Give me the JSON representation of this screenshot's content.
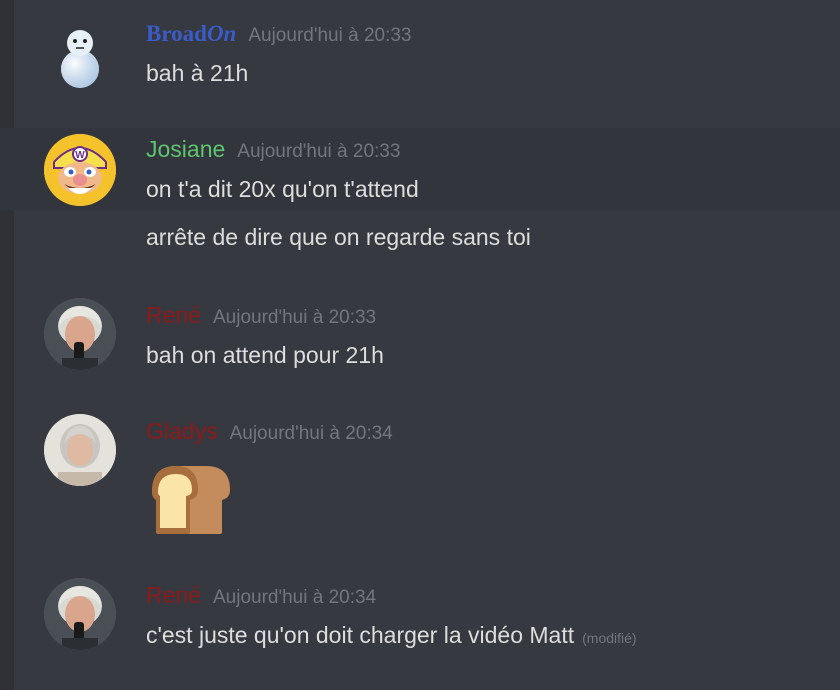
{
  "messages": [
    {
      "author": "Broad",
      "author_suffix": "On",
      "author_color": "#3b5bc9",
      "timestamp": "Aujourd'hui à 20:33",
      "lines": [
        "bah à 21h"
      ],
      "avatar_icon": "snowman-icon"
    },
    {
      "author": "Josiane",
      "author_color": "#5ec46f",
      "timestamp": "Aujourd'hui à 20:33",
      "lines": [
        "on t'a dit 20x qu'on t'attend",
        "arrête de dire que on regarde sans toi"
      ],
      "avatar_icon": "wario-avatar"
    },
    {
      "author": "René",
      "author_color": "#8b1a1a",
      "timestamp": "Aujourd'hui à 20:33",
      "lines": [
        "bah on attend pour 21h"
      ],
      "avatar_icon": "man-with-microphone-avatar"
    },
    {
      "author": "Gladys",
      "author_color": "#8b1a1a",
      "timestamp": "Aujourd'hui à 20:34",
      "lines": [],
      "emoji": "bread-emoji",
      "avatar_icon": "woman-portrait-avatar"
    },
    {
      "author": "René",
      "author_color": "#8b1a1a",
      "timestamp": "Aujourd'hui à 20:34",
      "lines": [
        "c'est juste qu'on doit charger la vidéo Matt"
      ],
      "edited_label": "(modifié)",
      "avatar_icon": "man-with-microphone-avatar"
    }
  ]
}
